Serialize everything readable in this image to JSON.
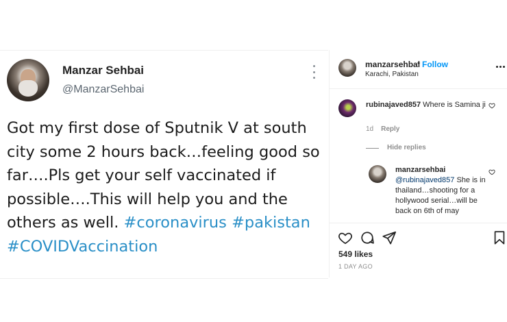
{
  "tweet": {
    "name": "Manzar Sehbai",
    "handle": "@ManzarSehbai",
    "text": "Got my first dose of Sputnik V at south city some 2 hours back…feeling good so far….Pls get your self vaccinated if possible….This will help you and the others as well.",
    "hashtags": [
      "#coronavirus",
      "#pakistan",
      "#COVIDVaccination"
    ]
  },
  "post_header": {
    "username": "manzarsehbai",
    "dot": "•",
    "follow_label": "Follow",
    "location": "Karachi, Pakistan"
  },
  "comment": {
    "username": "rubinajaved857",
    "text": "Where is Samina ji",
    "age": "1d",
    "reply_label": "Reply",
    "hide_replies_label": "Hide replies"
  },
  "reply": {
    "username": "manzarsehbai",
    "mention": "@rubinajaved857",
    "text": "She is in thailand…shooting for a hollywood serial…will be back on 6th of may"
  },
  "likes": "549 likes",
  "date": "1 DAY AGO",
  "icons": [
    "more-icon",
    "heart-icon",
    "comment-icon",
    "share-icon",
    "bookmark-icon"
  ],
  "colors": {
    "accent": "#0095f6",
    "hashtag": "#2a8fc7",
    "muted": "#8e8e8e"
  }
}
